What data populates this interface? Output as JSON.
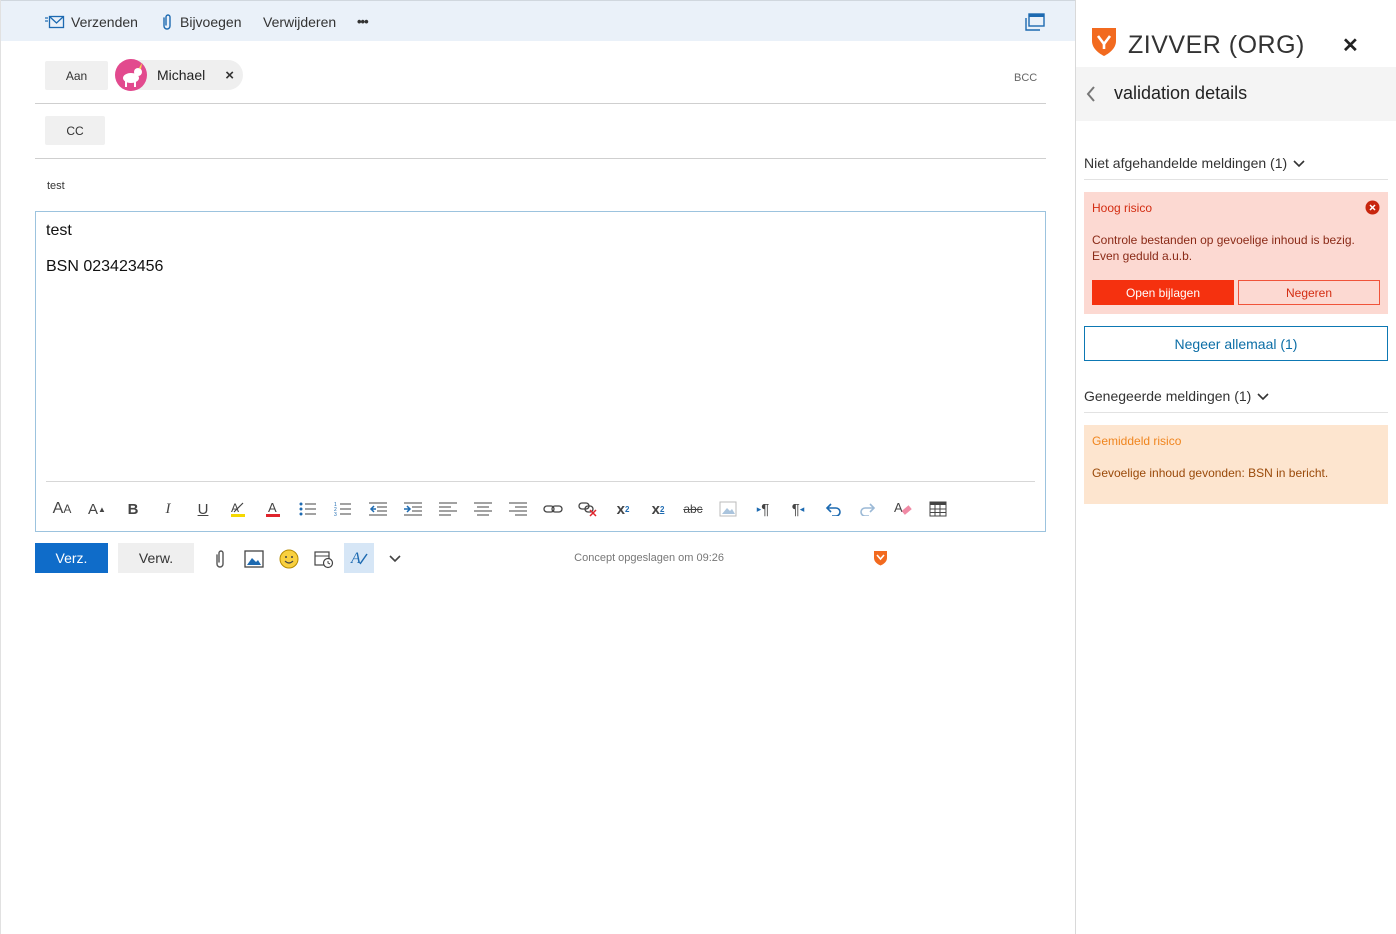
{
  "toolbar": {
    "send_label": "Verzenden",
    "attach_label": "Bijvoegen",
    "delete_label": "Verwijderen",
    "more_label": "•••"
  },
  "recipients": {
    "to_label": "Aan",
    "cc_label": "CC",
    "bcc_label": "BCC",
    "to": [
      {
        "name": "Michael"
      }
    ]
  },
  "subject": "test",
  "body": {
    "lines": [
      "test",
      "BSN 023423456"
    ]
  },
  "format_toolbar": {
    "items": [
      "font-size-icon",
      "grow-font-icon",
      "bold-icon",
      "italic-icon",
      "underline-icon",
      "highlight-icon",
      "font-color-icon",
      "bullets-icon",
      "numbering-icon",
      "outdent-icon",
      "indent-icon",
      "align-left-icon",
      "align-center-icon",
      "align-right-icon",
      "link-icon",
      "unlink-icon",
      "superscript-icon",
      "subscript-icon",
      "strikethrough-icon",
      "image-icon",
      "ltr-icon",
      "rtl-icon",
      "undo-icon",
      "redo-icon",
      "clear-format-icon",
      "table-icon"
    ]
  },
  "bottom": {
    "send_label": "Verz.",
    "discard_label": "Verw.",
    "saved_text": "Concept opgeslagen om 09:26"
  },
  "panel": {
    "title": "ZIVVER (ORG)",
    "subheader": "validation details",
    "unhandled_title": "Niet afgehandelde meldingen (1)",
    "high_risk": {
      "label": "Hoog risico",
      "message": "Controle bestanden op gevoelige inhoud is bezig. Even geduld a.u.b.",
      "open_label": "Open bijlagen",
      "ignore_label": "Negeren"
    },
    "ignore_all_label": "Negeer allemaal (1)",
    "ignored_title": "Genegeerde meldingen (1)",
    "medium_risk": {
      "label": "Gemiddeld risico",
      "message": "Gevoelige inhoud gevonden: BSN in bericht."
    }
  },
  "colors": {
    "accent": "#0f6cc9",
    "zivver_orange": "#f26a1f",
    "high_risk_bg": "#fcd9d2",
    "medium_risk_bg": "#fde5cf"
  }
}
